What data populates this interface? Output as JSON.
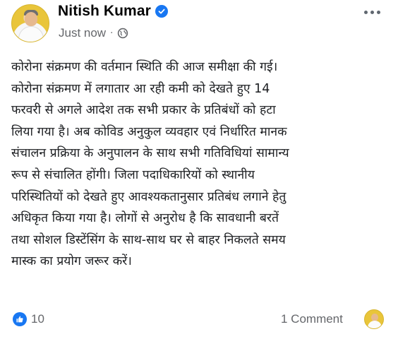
{
  "post": {
    "author": "Nitish Kumar",
    "timestamp": "Just now",
    "separator": "·",
    "privacy_icon": "globe-icon",
    "verified_icon": "verified-badge-icon",
    "more_icon": "more-options-icon",
    "lines": [
      "कोरोना संक्रमण की वर्तमान स्थिति की आज समीक्षा की गई।",
      "कोरोना संक्रमण में लगातार आ रही कमी को देखते हुए 14",
      "फरवरी से अगले आदेश तक सभी प्रकार के प्रतिबंधों को हटा",
      "लिया गया है। अब कोविड अनुकुल व्यवहार एवं निर्धारित मानक",
      "संचालन प्रक्रिया के अनुपालन के साथ सभी गतिविधियां सामान्य",
      "रूप से संचालित होंगी। जिला पदाधिकारियों को स्थानीय",
      "परिस्थितियों को देखते हुए आवश्यकतानुसार प्रतिबंध लगाने हेतु",
      "अधिकृत किया गया है। लोगों से अनुरोध है कि सावधानी बरतें",
      "तथा सोशल डिस्टेंसिंग के साथ-साथ घर से बाहर निकलते समय",
      "मास्क का प्रयोग जरूर करें।"
    ]
  },
  "footer": {
    "like_icon": "like-icon",
    "like_count": "10",
    "comment_count": "1 Comment"
  },
  "colors": {
    "accent": "#1877f2",
    "meta": "#65676b",
    "text": "#1c1e21"
  }
}
